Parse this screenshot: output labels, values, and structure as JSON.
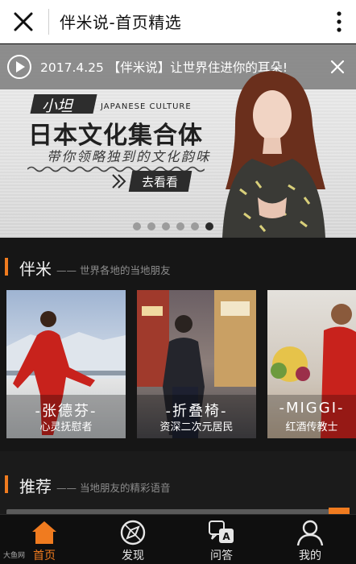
{
  "header": {
    "title": "伴米说-首页精选",
    "close_icon": "close-icon",
    "more_icon": "more-vertical-icon"
  },
  "banner": {
    "notice": "2017.4.25 【伴米说】让世界住进你的耳朵!",
    "tag": "小坦",
    "tag_en": "JAPANESE CULTURE",
    "headline": "日本文化集合体",
    "subline": "带你领略独到的文化韵味",
    "cta": "去看看",
    "slide_count": 6,
    "active_slide": 6
  },
  "section_friends": {
    "title": "伴米",
    "subtitle": "—— 世界各地的当地朋友",
    "cards": [
      {
        "name": "-张德芬-",
        "role": "心灵抚慰者"
      },
      {
        "name": "-折叠椅-",
        "role": "资深二次元居民"
      },
      {
        "name": "-MIGGI-",
        "role": "红酒传教士"
      }
    ]
  },
  "section_recommend": {
    "title": "推荐",
    "subtitle": "—— 当地朋友的精彩语音"
  },
  "tabbar": {
    "items": [
      {
        "label": "首页",
        "icon": "home-icon",
        "active": true
      },
      {
        "label": "发现",
        "icon": "discover-icon",
        "active": false
      },
      {
        "label": "问答",
        "icon": "qa-icon",
        "active": false
      },
      {
        "label": "我的",
        "icon": "profile-icon",
        "active": false
      }
    ]
  },
  "watermark": "大鱼网",
  "colors": {
    "accent": "#f07b1f",
    "background": "#161616",
    "header_bg": "#ffffff"
  }
}
